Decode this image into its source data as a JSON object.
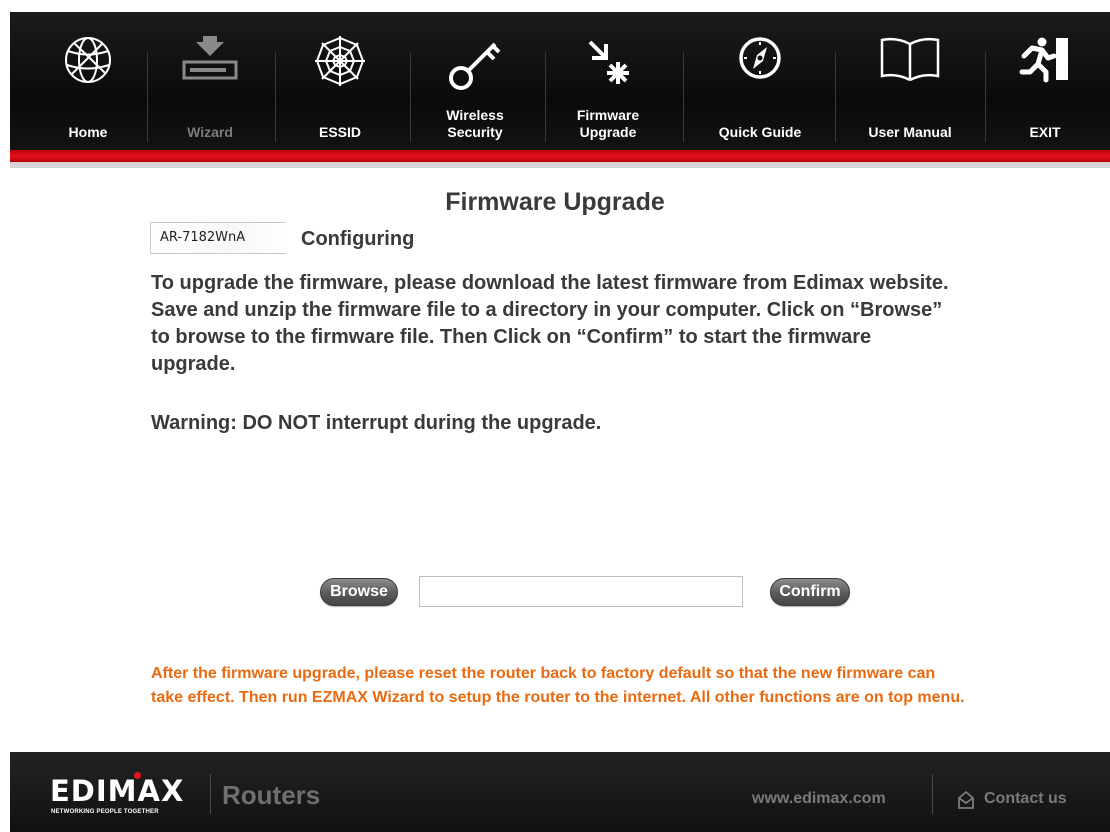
{
  "nav": {
    "items": [
      {
        "label": "Home",
        "icon": "globe-icon",
        "state": "normal"
      },
      {
        "label": "Wizard",
        "icon": "wizard-device-icon",
        "state": "disabled"
      },
      {
        "label": "ESSID",
        "icon": "spiderweb-icon",
        "state": "normal"
      },
      {
        "label": "Wireless\nSecurity",
        "icon": "key-icon",
        "state": "normal"
      },
      {
        "label": "Firmware\nUpgrade",
        "icon": "firmware-arrow-icon",
        "state": "normal"
      },
      {
        "label": "Quick Guide",
        "icon": "compass-icon",
        "state": "normal"
      },
      {
        "label": "User Manual",
        "icon": "open-book-icon",
        "state": "normal"
      },
      {
        "label": "EXIT",
        "icon": "exit-running-man-icon",
        "state": "normal"
      }
    ]
  },
  "main": {
    "title": "Firmware Upgrade",
    "model": "AR-7182WnA",
    "status": "Configuring",
    "instructions": "To upgrade the firmware, please download the latest firmware from Edimax website. Save and unzip the firmware file to a directory in your computer. Click on “Browse” to browse to the firmware file. Then Click on “Confirm” to start the firmware upgrade.",
    "warning": "Warning: DO NOT interrupt during the upgrade.",
    "browse_label": "Browse",
    "file_path": "",
    "confirm_label": "Confirm",
    "note": "After the firmware upgrade, please reset the router back to factory default so that the new firmware can take effect. Then run EZMAX Wizard to setup the router to the internet. All other functions are on top menu."
  },
  "footer": {
    "logo_text": "EDIMAX",
    "logo_tagline": "NETWORKING PEOPLE TOGETHER",
    "section": "Routers",
    "website": "www.edimax.com",
    "contact": "Contact us"
  },
  "colors": {
    "nav_background": "#111111",
    "nav_accent_red": "#e2141e",
    "note_orange": "#e96a10",
    "button_grey": "#5a5a5a"
  }
}
